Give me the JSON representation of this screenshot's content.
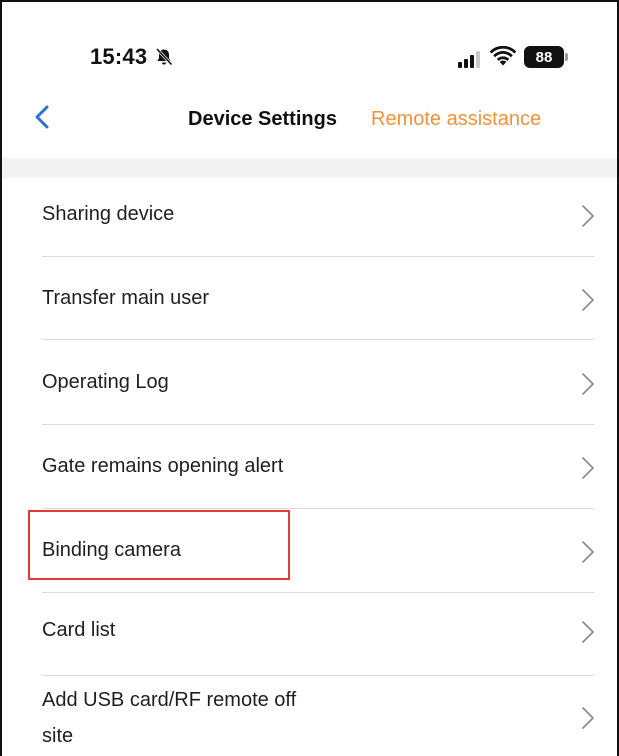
{
  "status_bar": {
    "time": "15:43",
    "battery": "88",
    "icons": [
      "bell-slash-icon",
      "cellular-signal-icon",
      "wifi-icon",
      "battery-icon"
    ]
  },
  "nav": {
    "back_icon": "chevron-left-icon",
    "title": "Device Settings",
    "action": "Remote assistance"
  },
  "colors": {
    "accent": "#f0923a",
    "back": "#2f6fd6",
    "highlight": "#e2393b",
    "section_bg": "#f2f2f2"
  },
  "items": [
    {
      "label": "Sharing device"
    },
    {
      "label": "Transfer main user"
    },
    {
      "label": "Operating Log"
    },
    {
      "label": "Gate remains opening alert"
    },
    {
      "label": "Binding camera",
      "highlighted": true
    },
    {
      "label": "Card list"
    },
    {
      "label": "Add USB card/RF remote off\nsite"
    }
  ]
}
